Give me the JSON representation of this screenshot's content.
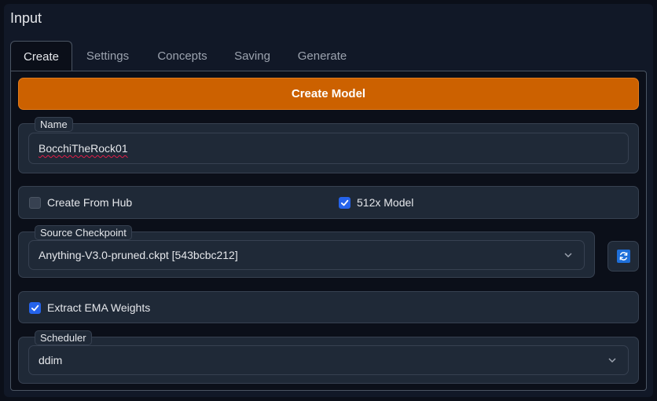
{
  "section": {
    "title": "Input"
  },
  "tabs": [
    "Create",
    "Settings",
    "Concepts",
    "Saving",
    "Generate"
  ],
  "active_tab": "Create",
  "create": {
    "button_label": "Create Model",
    "name": {
      "label": "Name",
      "value": "BocchiTheRock01"
    },
    "create_from_hub": {
      "label": "Create From Hub",
      "checked": false
    },
    "model_512": {
      "label": "512x Model",
      "checked": true
    },
    "source_checkpoint": {
      "label": "Source Checkpoint",
      "value": "Anything-V3.0-pruned.ckpt [543bcbc212]"
    },
    "refresh": {
      "icon": "refresh-icon"
    },
    "extract_ema": {
      "label": "Extract EMA Weights",
      "checked": true
    },
    "scheduler": {
      "label": "Scheduler",
      "value": "ddim"
    }
  },
  "colors": {
    "accent": "#cc6100",
    "checkbox_on": "#2563eb",
    "refresh_icon": "#1e6fd9",
    "background": "#0b0f19",
    "block": "#1f2937"
  }
}
